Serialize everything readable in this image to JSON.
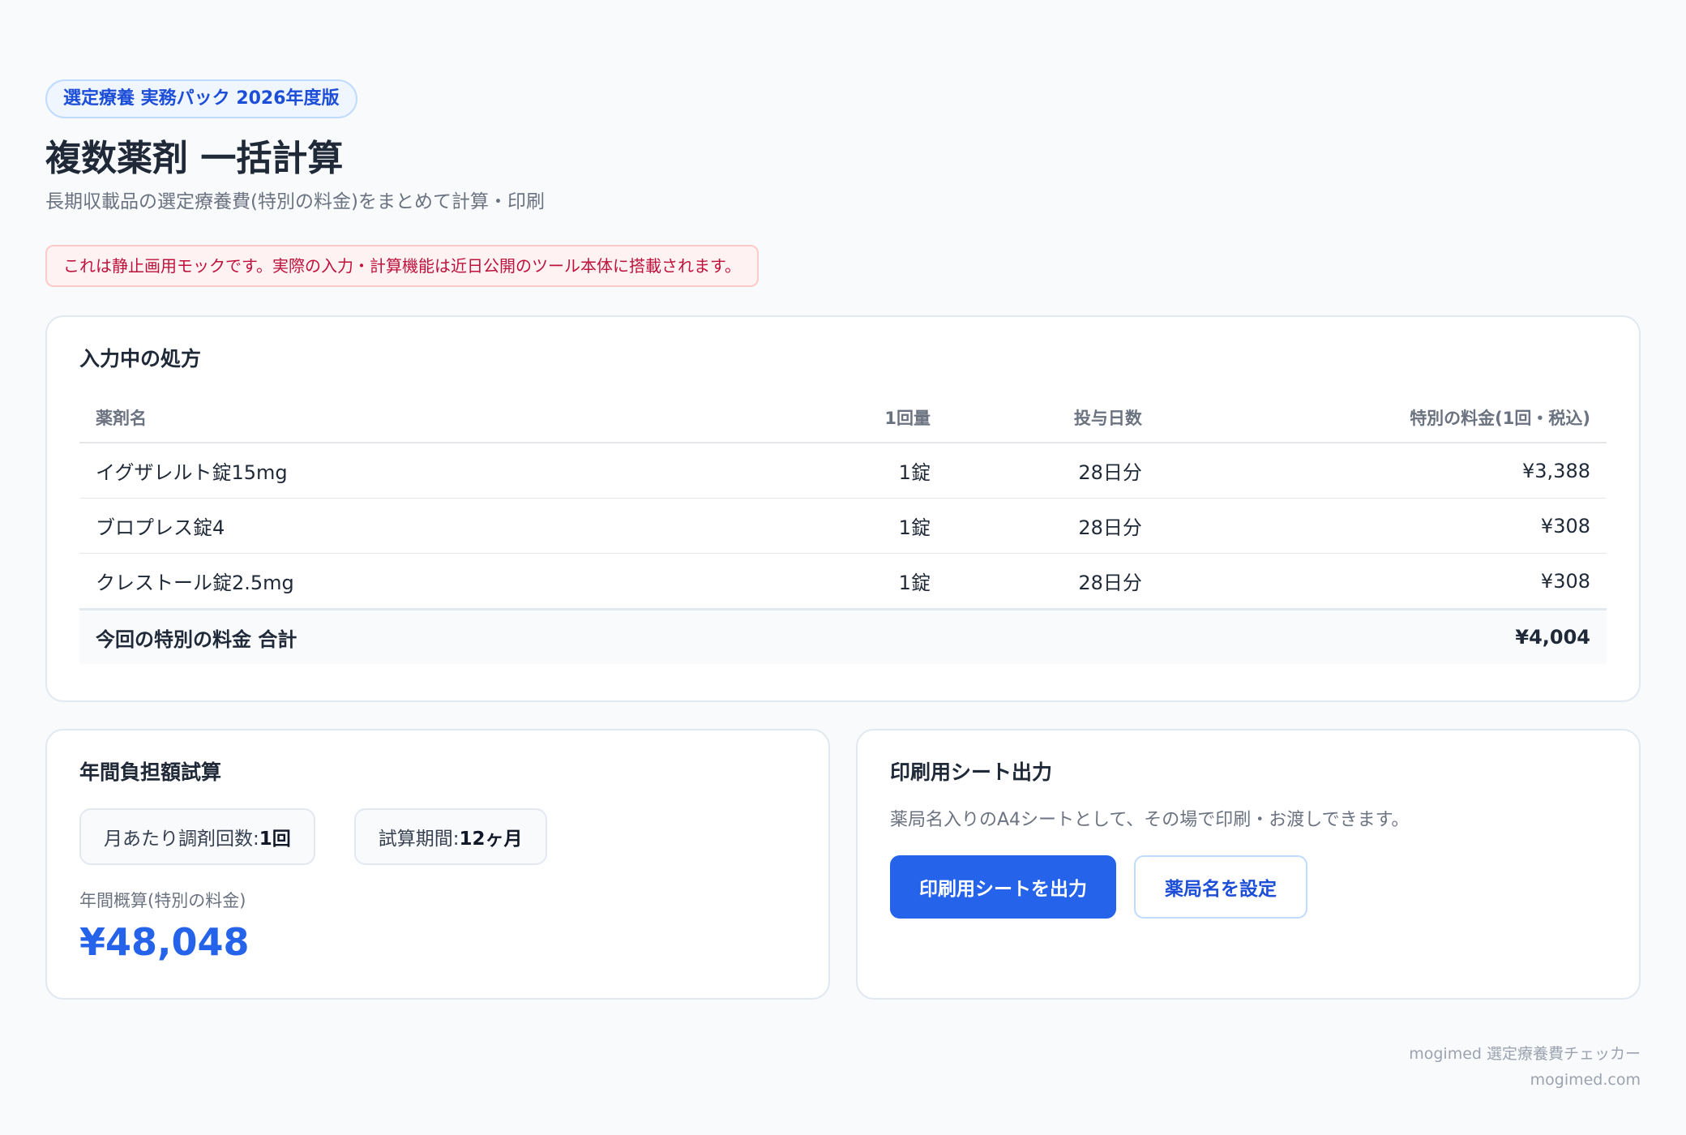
{
  "header": {
    "badge": "選定療養 実務パック 2026年度版",
    "title": "複数薬剤 一括計算",
    "subtitle": "長期収載品の選定療養費(特別の料金)をまとめて計算・印刷",
    "notice": "これは静止画用モックです。実際の入力・計算機能は近日公開のツール本体に搭載されます。"
  },
  "prescription": {
    "title": "入力中の処方",
    "columns": [
      "薬剤名",
      "1回量",
      "投与日数",
      "特別の料金(1回・税込)"
    ],
    "rows": [
      {
        "name": "イグザレルト錠15mg",
        "dose": "1錠",
        "days": "28日分",
        "fee": "¥3,388"
      },
      {
        "name": "ブロプレス錠4",
        "dose": "1錠",
        "days": "28日分",
        "fee": "¥308"
      },
      {
        "name": "クレストール錠2.5mg",
        "dose": "1錠",
        "days": "28日分",
        "fee": "¥308"
      }
    ],
    "total_label": "今回の特別の料金 合計",
    "total_value": "¥4,004"
  },
  "annual": {
    "title": "年間負担額試算",
    "frequency_label": "月あたり調剤回数:",
    "frequency_value": "1回",
    "period_label": "試算期間:",
    "period_value": "12ヶ月",
    "estimate_label": "年間概算(特別の料金)",
    "estimate_value": "¥48,048"
  },
  "print": {
    "title": "印刷用シート出力",
    "description": "薬局名入りのA4シートとして、その場で印刷・お渡しできます。",
    "primary_button": "印刷用シートを出力",
    "secondary_button": "薬局名を設定"
  },
  "footer": {
    "product": "mogimed 選定療養費チェッカー",
    "site": "mogimed.com"
  },
  "colors": {
    "accent": "#2563eb",
    "notice": "#be123c"
  }
}
